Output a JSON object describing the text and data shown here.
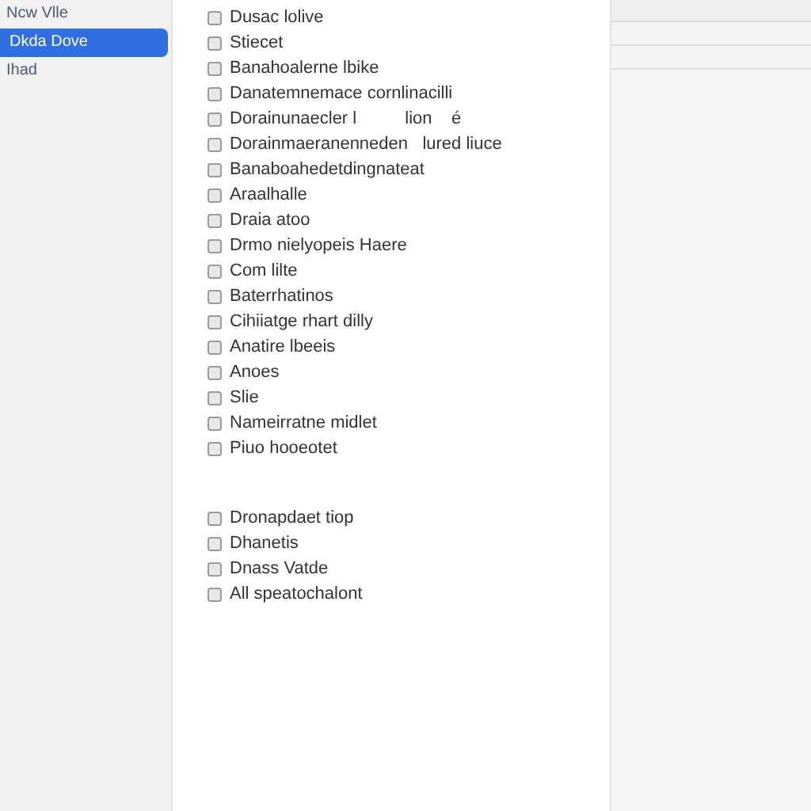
{
  "sidebar": {
    "items": [
      {
        "label": "Ncw Vlle",
        "selected": false
      },
      {
        "label": "Dkda Dove",
        "selected": true
      },
      {
        "label": "Ihad",
        "selected": false
      }
    ]
  },
  "groups": [
    {
      "items": [
        {
          "label": "Dusac lolive",
          "checked": false
        },
        {
          "label": "Stiecet",
          "checked": false
        },
        {
          "label": "Banahoalerne lbike",
          "checked": false
        },
        {
          "label": "Danatemnemace cornlinacilli",
          "checked": false
        },
        {
          "label": "Dorainunaecler l          lion    é",
          "checked": false
        },
        {
          "label": "Dorainmaeranenneden   lured liuce",
          "checked": false
        },
        {
          "label": "Banaboahedetdingnateat",
          "checked": false
        },
        {
          "label": "Araalhalle",
          "checked": false
        },
        {
          "label": "Draia atoo",
          "checked": false
        },
        {
          "label": "Drmo nielyopeis Haere",
          "checked": false
        },
        {
          "label": "Com lilte",
          "checked": false
        },
        {
          "label": "Baterrhatinos",
          "checked": false
        },
        {
          "label": "Cihiiatge rhart dilly",
          "checked": false
        },
        {
          "label": "Anatire lbeeis",
          "checked": false
        },
        {
          "label": "Anoes",
          "checked": false
        },
        {
          "label": "Slie",
          "checked": false
        },
        {
          "label": "Nameirratne midlet",
          "checked": false
        },
        {
          "label": "Piuo hooeotet",
          "checked": false
        }
      ]
    },
    {
      "items": [
        {
          "label": "Dronapdaet tiop",
          "checked": false
        },
        {
          "label": "Dhanetis",
          "checked": false
        },
        {
          "label": "Dnass Vatde",
          "checked": false
        },
        {
          "label": "All speatochalont",
          "checked": false
        }
      ]
    }
  ]
}
